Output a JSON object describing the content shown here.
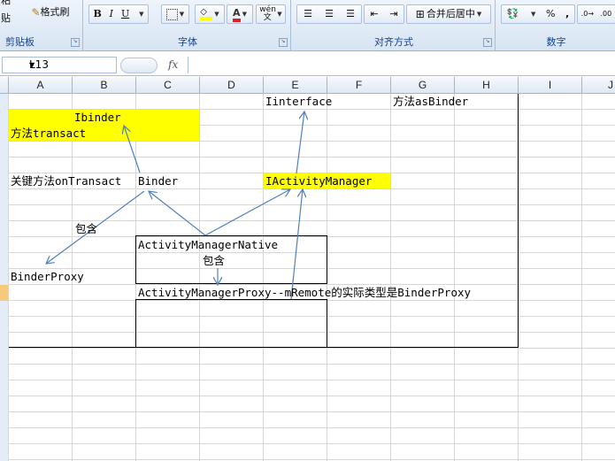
{
  "ribbon": {
    "clipboard": {
      "paste_label": "粘贴",
      "format_painter_label": "格式刷",
      "group_label": "剪贴板"
    },
    "font": {
      "bold": "B",
      "italic": "I",
      "underline": "U",
      "font_color_letter": "A",
      "phonetic_label": "wén 文",
      "group_label": "字体"
    },
    "alignment": {
      "merge_label": "合并后居中",
      "group_label": "对齐方式"
    },
    "number": {
      "percent": "%",
      "comma": ",",
      "group_label": "数字"
    }
  },
  "formula_bar": {
    "cell_ref": "L13",
    "fx_label": "fx",
    "formula": ""
  },
  "columns": [
    "A",
    "B",
    "C",
    "D",
    "E",
    "F",
    "G",
    "H",
    "I",
    "J"
  ],
  "cells": {
    "ibinder": "Ibinder",
    "method_transact": "方法transact",
    "iinterface": "Iinterface",
    "method_asbinder": "方法asBinder",
    "key_method": "关键方法onTransact",
    "binder": "Binder",
    "iactivitymanager": "IActivityManager",
    "contains_1": "包含",
    "amn": "ActivityManagerNative",
    "contains_2": "包含",
    "binderproxy": "BinderProxy",
    "amp": "ActivityManagerProxy--mRemote的实际类型是BinderProxy"
  },
  "colors": {
    "highlight": "#ffff00",
    "arrow": "#4f81bd"
  }
}
